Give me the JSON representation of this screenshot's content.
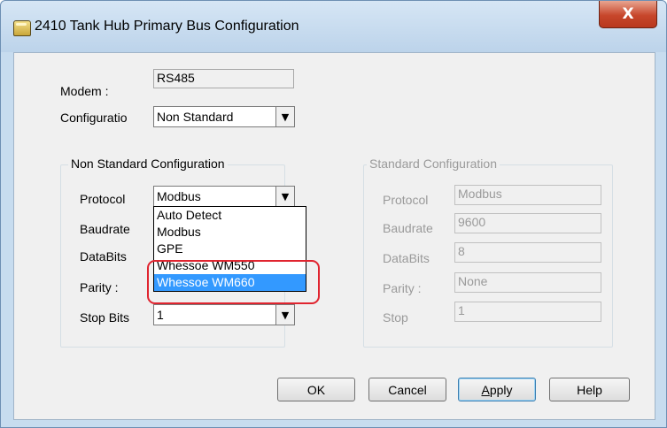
{
  "window": {
    "title": "2410 Tank Hub Primary Bus Configuration",
    "close_glyph": "X"
  },
  "modem": {
    "label": "Modem :",
    "value": "RS485"
  },
  "configuration": {
    "label": "Configuratio",
    "value": "Non Standard"
  },
  "non_standard": {
    "title": "Non Standard Configuration",
    "protocol_label": "Protocol",
    "protocol_value": "Modbus",
    "baudrate_label": "Baudrate",
    "databits_label": "DataBits",
    "parity_label": "Parity :",
    "stopbits_label": "Stop Bits",
    "stopbits_value": "1",
    "protocol_options": [
      "Auto Detect",
      "Modbus",
      "GPE",
      "Whessoe WM550",
      "Whessoe WM660"
    ],
    "selected_option": "Whessoe WM660"
  },
  "standard": {
    "title": "Standard Configuration",
    "protocol_label": "Protocol",
    "protocol_value": "Modbus",
    "baudrate_label": "Baudrate",
    "baudrate_value": "9600",
    "databits_label": "DataBits",
    "databits_value": "8",
    "parity_label": "Parity :",
    "parity_value": "None",
    "stop_label": "Stop",
    "stop_value": "1"
  },
  "buttons": {
    "ok": "OK",
    "cancel": "Cancel",
    "apply_accel": "A",
    "apply_rest": "pply",
    "help": "Help"
  },
  "colors": {
    "highlight": "#e0242f",
    "selection": "#3399ff",
    "close_button": "#c7462b"
  }
}
